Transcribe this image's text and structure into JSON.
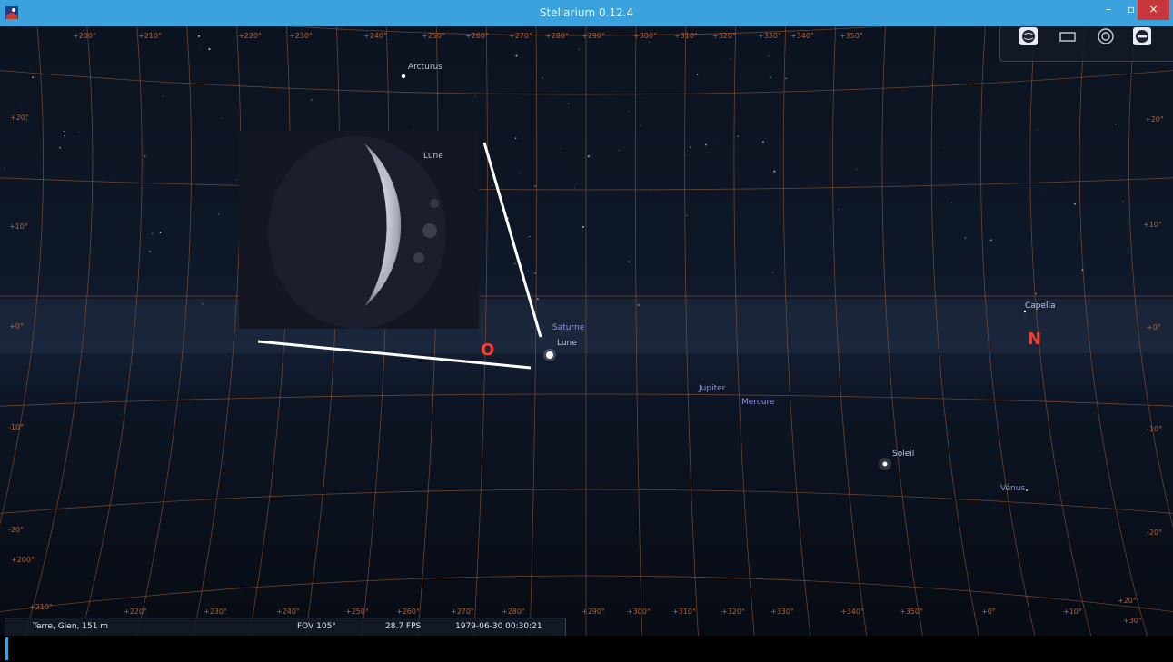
{
  "window": {
    "title": "Stellarium 0.12.4",
    "controls": {
      "minimize": "–",
      "maximize": "▫",
      "close": "×"
    }
  },
  "sky": {
    "stars": [
      {
        "label": "Arcturus"
      },
      {
        "label": "Capella"
      }
    ],
    "planets": [
      {
        "label": "Saturne"
      },
      {
        "label": "Lune"
      },
      {
        "label": "Jupiter"
      },
      {
        "label": "Mercure"
      },
      {
        "label": "Soleil"
      },
      {
        "label": "Vénus"
      }
    ],
    "cardinals": {
      "west": "O",
      "north": "N"
    },
    "grid_labels": {
      "dec": [
        "+20°",
        "+10°",
        "+0°",
        "-10°",
        "-20°",
        "+20°",
        "+10°",
        "+0°",
        "-10°",
        "-20°"
      ],
      "ra_top": [
        "+200°",
        "+210°",
        "+220°",
        "+230°",
        "+240°",
        "+250°",
        "+260°",
        "+270°",
        "+280°",
        "+290°",
        "+300°",
        "+310°",
        "+320°",
        "+330°",
        "+340°",
        "+350°"
      ],
      "ra_bottom": [
        "+200°",
        "+210°",
        "+220°",
        "+230°",
        "+240°",
        "+250°",
        "+260°",
        "+270°",
        "+280°",
        "+290°",
        "+300°",
        "+310°",
        "+320°",
        "+330°",
        "+340°",
        "+350°",
        "+0°",
        "+10°",
        "+20°",
        "+30°"
      ]
    }
  },
  "moon_inset": {
    "label": "Lune"
  },
  "toolbar": {
    "items": [
      {
        "icon": "globe-icon"
      },
      {
        "icon": "rectangle-icon"
      },
      {
        "icon": "target-icon"
      },
      {
        "icon": "quit-icon"
      }
    ]
  },
  "status": {
    "location": "Terre, Gien, 151 m",
    "fov": "FOV 105°",
    "fps": "28.7 FPS",
    "datetime": "1979-06-30   00:30:21"
  },
  "colors": {
    "titlebar": "#3aa2dc",
    "grid": "#8a5436",
    "cardinal": "#ff3b2c",
    "planet_label": "#8e96d9"
  }
}
